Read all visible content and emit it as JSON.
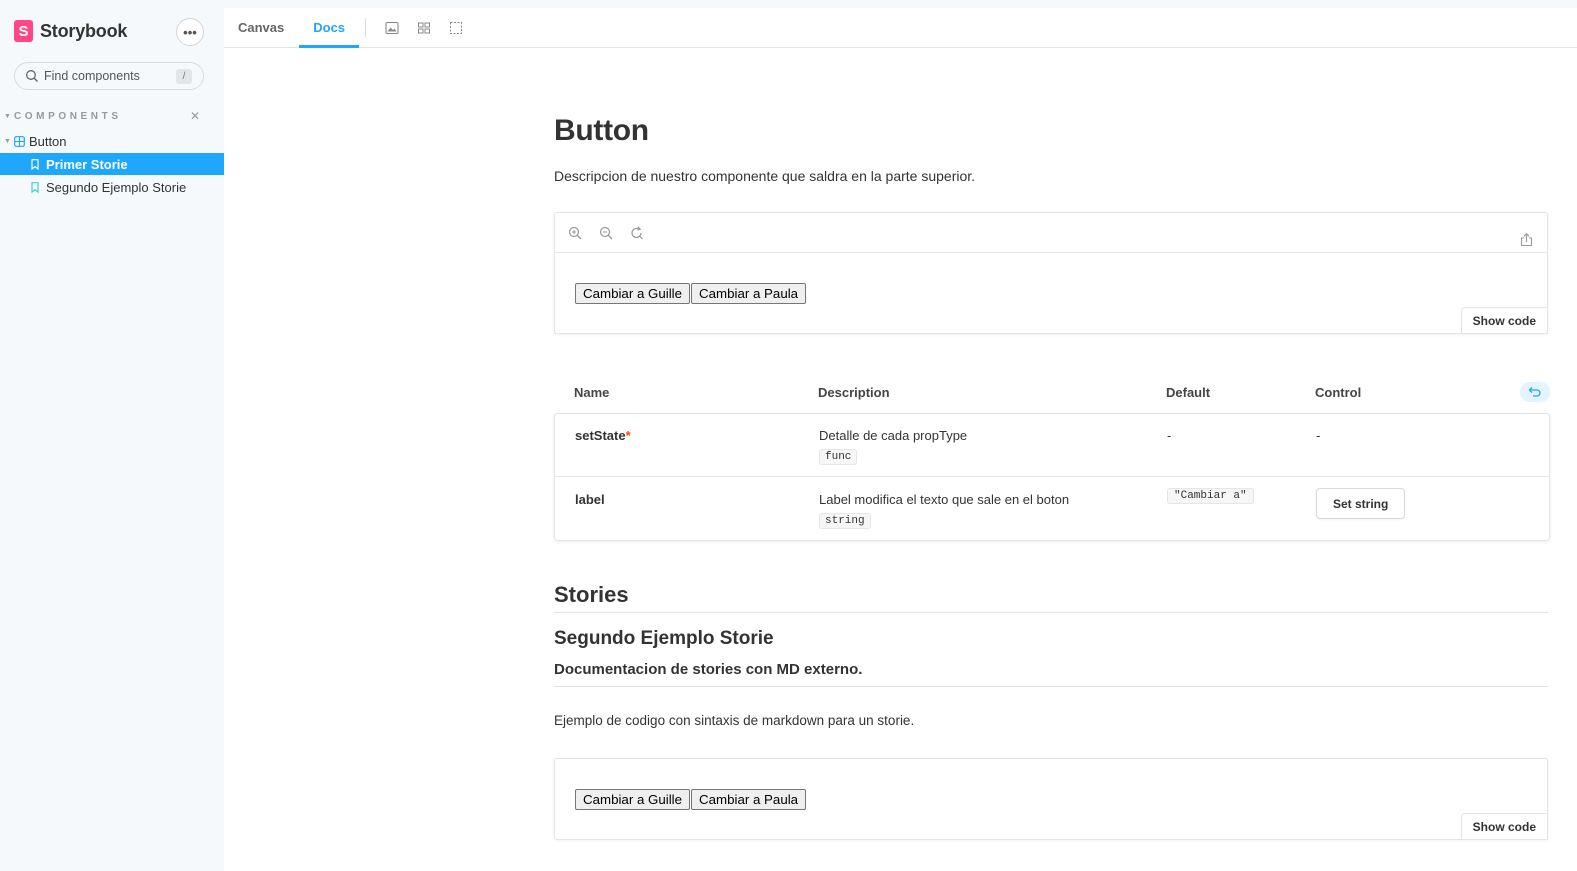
{
  "app": {
    "brand": "Storybook",
    "menu_label": "•••"
  },
  "sidebar": {
    "search_placeholder": "Find components",
    "search_shortcut": "/",
    "section_label": "COMPONENTS",
    "component": "Button",
    "stories": [
      "Primer Storie",
      "Segundo Ejemplo Storie"
    ],
    "active_story": "Primer Storie"
  },
  "toolbar": {
    "tabs": [
      "Canvas",
      "Docs"
    ],
    "active_tab": "Docs",
    "icons": [
      "image-icon",
      "grid-icon",
      "outline-icon"
    ]
  },
  "doc": {
    "title": "Button",
    "description": "Descripcion de nuestro componente que saldra en la parte superior.",
    "preview": {
      "buttons": [
        "Cambiar a Guille",
        "Cambiar a Paula"
      ],
      "show_code": "Show code",
      "zoom_icons": [
        "zoom-in-icon",
        "zoom-out-icon",
        "zoom-reset-icon"
      ]
    },
    "props_table": {
      "headers": {
        "name": "Name",
        "description": "Description",
        "default": "Default",
        "control": "Control"
      },
      "rows": [
        {
          "name": "setState",
          "required": "*",
          "description": "Detalle de cada propType",
          "type": "func",
          "default": "-",
          "control": "-"
        },
        {
          "name": "label",
          "description": "Label modifica el texto que sale en el boton",
          "type": "string",
          "default": "\"Cambiar a\"",
          "control": "Set string"
        }
      ]
    },
    "stories_heading": "Stories",
    "story": {
      "title": "Segundo Ejemplo Storie",
      "subtitle": "Documentacion de stories con MD externo.",
      "text": "Ejemplo de codigo con sintaxis de markdown para un storie.",
      "buttons": [
        "Cambiar a Guille",
        "Cambiar a Paula"
      ],
      "show_code": "Show code"
    }
  },
  "colors": {
    "accent": "#1ea7fd",
    "brand": "#ff4785",
    "required": "#ff4400"
  }
}
